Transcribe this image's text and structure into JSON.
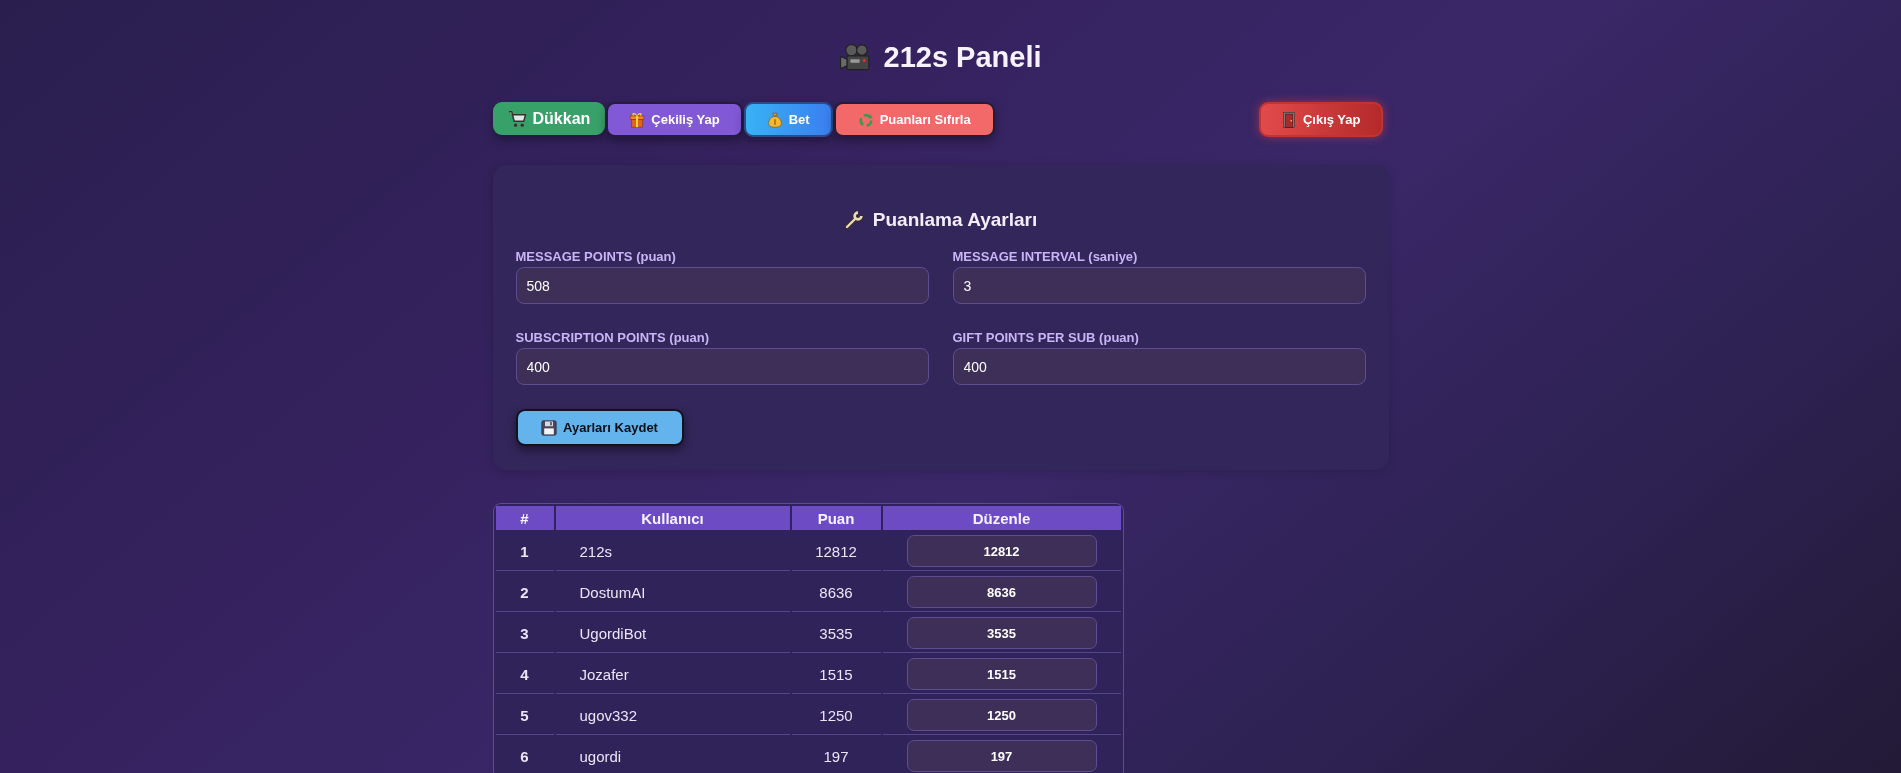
{
  "page": {
    "title": "212s Paneli"
  },
  "toolbar": {
    "buttons": [
      {
        "kind": "shop",
        "label": "Dükkan"
      },
      {
        "kind": "raffle",
        "label": "Çekiliş Yap"
      },
      {
        "kind": "bet",
        "label": "Bet"
      },
      {
        "kind": "reset",
        "label": "Puanları Sıfırla"
      },
      {
        "kind": "logout",
        "label": "Çıkış Yap"
      }
    ]
  },
  "settings": {
    "title": "Puanlama Ayarları",
    "fields": [
      {
        "label": "MESSAGE POINTS (puan)",
        "value": "508"
      },
      {
        "label": "MESSAGE INTERVAL (saniye)",
        "value": "3"
      },
      {
        "label": "SUBSCRIPTION POINTS (puan)",
        "value": "400"
      },
      {
        "label": "GIFT POINTS PER SUB (puan)",
        "value": "400"
      }
    ],
    "save_button": "Ayarları Kaydet"
  },
  "leaderboard": {
    "columns": [
      "#",
      "Kullanıcı",
      "Puan",
      "Düzenle"
    ],
    "rows": [
      {
        "rank": "1",
        "user": "212s",
        "points": "12812",
        "edit_value": "12812"
      },
      {
        "rank": "2",
        "user": "DostumAI",
        "points": "8636",
        "edit_value": "8636"
      },
      {
        "rank": "3",
        "user": "UgordiBot",
        "points": "3535",
        "edit_value": "3535"
      },
      {
        "rank": "4",
        "user": "Jozafer",
        "points": "1515",
        "edit_value": "1515"
      },
      {
        "rank": "5",
        "user": "ugov332",
        "points": "1250",
        "edit_value": "1250"
      },
      {
        "rank": "6",
        "user": "ugordi",
        "points": "197",
        "edit_value": "197"
      }
    ]
  }
}
